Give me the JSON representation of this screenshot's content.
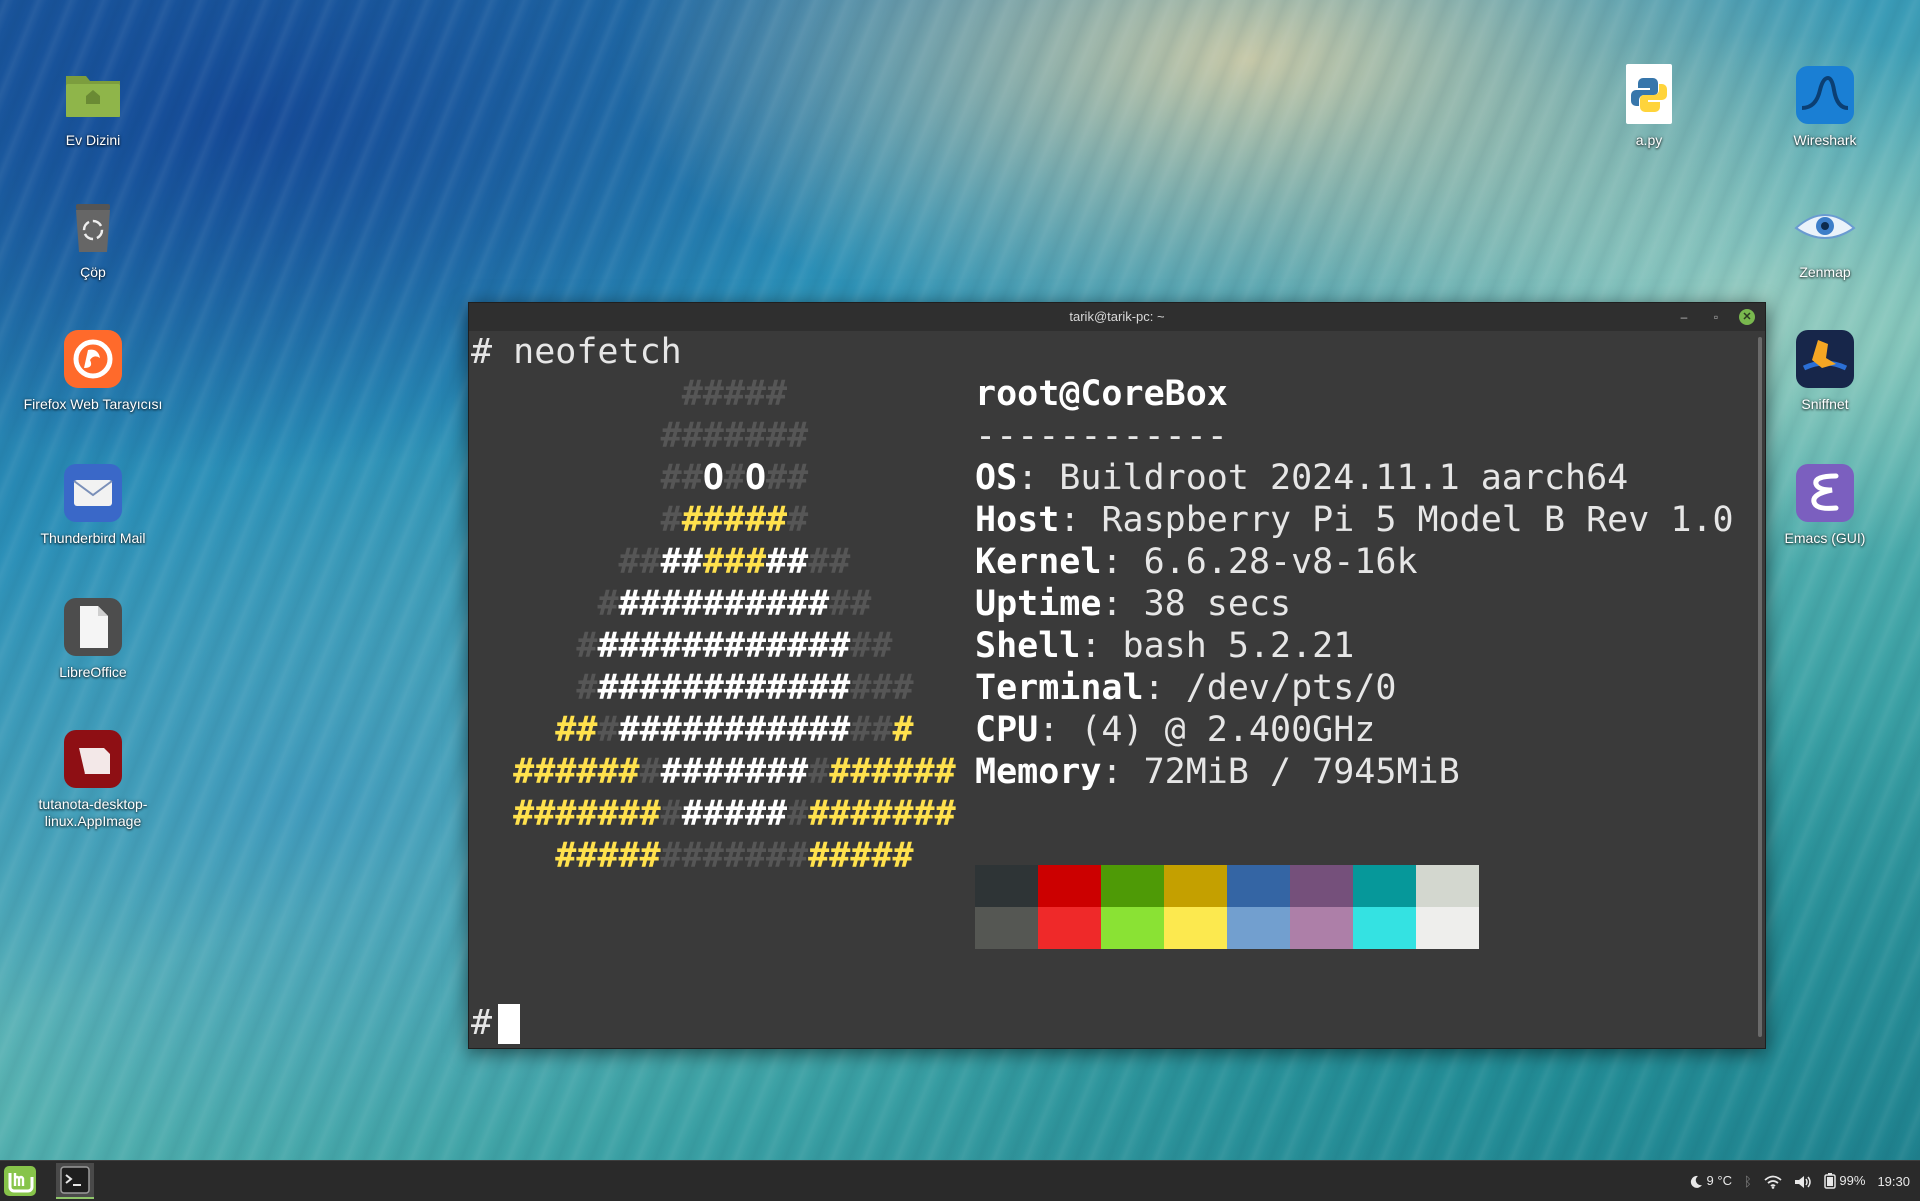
{
  "desktop": {
    "left_icons": [
      {
        "label": "Ev Dizini",
        "icon": "folder-home-icon"
      },
      {
        "label": "Çöp",
        "icon": "trash-icon"
      },
      {
        "label": "Firefox Web Tarayıcısı",
        "icon": "firefox-icon"
      },
      {
        "label": "Thunderbird Mail",
        "icon": "thunderbird-icon"
      },
      {
        "label": "LibreOffice",
        "icon": "libreoffice-icon"
      },
      {
        "label": "tutanota-desktop-linux.AppImage",
        "icon": "tutanota-icon"
      }
    ],
    "right_icons": [
      {
        "label": "a.py",
        "icon": "python-file-icon"
      },
      {
        "label": "Wireshark",
        "icon": "wireshark-icon"
      },
      {
        "label": "Zenmap",
        "icon": "zenmap-icon"
      },
      {
        "label": "Sniffnet",
        "icon": "sniffnet-icon"
      },
      {
        "label": "Emacs (GUI)",
        "icon": "emacs-icon"
      }
    ]
  },
  "terminal": {
    "title": "tarik@tarik-pc: ~",
    "command_line": "# neofetch",
    "prompt": "#",
    "user_host": "root@CoreBox",
    "separator": "------------",
    "info": [
      {
        "key": "OS",
        "value": ": Buildroot 2024.11.1 aarch64"
      },
      {
        "key": "Host",
        "value": ": Raspberry Pi 5 Model B Rev 1.0"
      },
      {
        "key": "Kernel",
        "value": ": 6.6.28-v8-16k"
      },
      {
        "key": "Uptime",
        "value": ": 38 secs"
      },
      {
        "key": "Shell",
        "value": ": bash 5.2.21"
      },
      {
        "key": "Terminal",
        "value": ": /dev/pts/0"
      },
      {
        "key": "CPU",
        "value": ": (4) @ 2.400GHz"
      },
      {
        "key": "Memory",
        "value": ": 72MiB / 7945MiB"
      }
    ],
    "palette_top": [
      "#2e3436",
      "#cc0000",
      "#4e9a06",
      "#c4a000",
      "#3465a4",
      "#75507b",
      "#06989a",
      "#d3d7cf"
    ],
    "palette_bottom": [
      "#555753",
      "#ef2929",
      "#8ae234",
      "#fce94f",
      "#729fcf",
      "#ad7fa8",
      "#34e2e2",
      "#eeeeec"
    ]
  },
  "taskbar": {
    "weather": "9 °C",
    "battery": "99%",
    "clock": "19:30"
  }
}
